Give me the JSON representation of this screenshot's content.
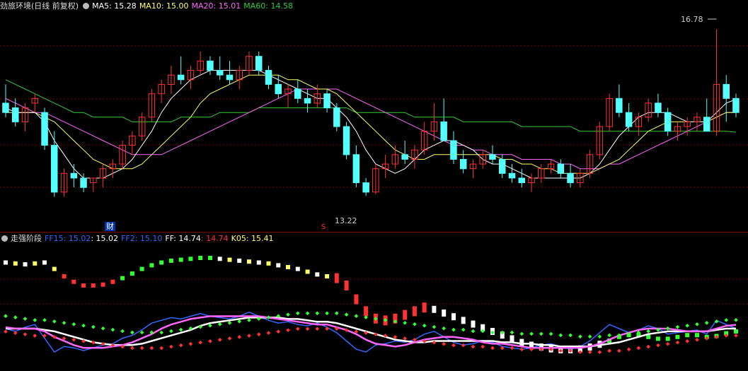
{
  "top": {
    "title": "劲旅环境(日线 前复权)",
    "ma5": "MA5: 15.28",
    "ma10": "MA10: 15.00",
    "ma20": "MA20: 15.01",
    "ma60": "MA60: 14.58",
    "high_label": "16.78",
    "low_label": "13.22",
    "cai_label": "财",
    "s_label": "S"
  },
  "bottom": {
    "title": "走强阶段",
    "ff15": "FF15: 15.02",
    "ff15_val": ": 15.02",
    "ff2": "FF2: 15.10",
    "ff": "FF: 14.74",
    "ff_red": ": 14.74",
    "k05": "K05: 15.41"
  },
  "colors": {
    "up": "#ff3232",
    "down": "#54ffff",
    "ma5": "#ffffff",
    "ma10": "#ffff66",
    "ma20": "#ff66ff",
    "ma60": "#33cc33",
    "ff15": "#3366ff",
    "ff2": "#3366ff",
    "ff": "#ffffff",
    "ffred": "#ff3232",
    "k05": "#ffff66"
  },
  "chart_data": {
    "type": "candlestick",
    "ylim": [
      12.8,
      17.1
    ],
    "candles": [
      [
        15.2,
        15.6,
        14.9,
        15.0
      ],
      [
        15.1,
        15.3,
        14.7,
        14.8
      ],
      [
        14.8,
        15.2,
        14.6,
        15.1
      ],
      [
        15.2,
        15.4,
        15.0,
        15.3
      ],
      [
        15.0,
        15.1,
        14.2,
        14.3
      ],
      [
        14.3,
        14.6,
        13.2,
        13.3
      ],
      [
        13.3,
        13.8,
        13.2,
        13.7
      ],
      [
        13.7,
        13.9,
        13.4,
        13.6
      ],
      [
        13.6,
        13.7,
        13.3,
        13.4
      ],
      [
        13.5,
        13.6,
        13.3,
        13.6
      ],
      [
        13.6,
        13.9,
        13.4,
        13.8
      ],
      [
        13.8,
        14.0,
        13.6,
        13.9
      ],
      [
        13.9,
        14.4,
        13.8,
        14.3
      ],
      [
        14.3,
        14.6,
        14.1,
        14.5
      ],
      [
        14.5,
        15.0,
        14.4,
        14.9
      ],
      [
        14.9,
        15.5,
        14.8,
        15.4
      ],
      [
        15.4,
        15.7,
        15.2,
        15.6
      ],
      [
        15.6,
        16.0,
        15.4,
        15.8
      ],
      [
        15.8,
        16.2,
        15.6,
        15.7
      ],
      [
        15.7,
        16.0,
        15.5,
        15.9
      ],
      [
        15.9,
        16.3,
        15.8,
        16.1
      ],
      [
        16.1,
        16.2,
        15.8,
        15.9
      ],
      [
        15.9,
        16.2,
        15.7,
        15.8
      ],
      [
        15.8,
        16.1,
        15.6,
        15.7
      ],
      [
        15.7,
        16.0,
        15.5,
        15.9
      ],
      [
        15.9,
        16.3,
        15.8,
        16.2
      ],
      [
        16.2,
        16.3,
        15.8,
        15.9
      ],
      [
        15.9,
        16.0,
        15.5,
        15.6
      ],
      [
        15.6,
        15.8,
        15.3,
        15.4
      ],
      [
        15.4,
        15.6,
        15.1,
        15.5
      ],
      [
        15.5,
        15.7,
        15.2,
        15.3
      ],
      [
        15.3,
        15.5,
        15.0,
        15.2
      ],
      [
        15.2,
        15.6,
        15.1,
        15.4
      ],
      [
        15.4,
        15.5,
        15.0,
        15.1
      ],
      [
        15.1,
        15.2,
        14.6,
        14.7
      ],
      [
        14.7,
        14.8,
        14.0,
        14.1
      ],
      [
        14.1,
        14.3,
        13.4,
        13.5
      ],
      [
        13.5,
        13.6,
        13.22,
        13.3
      ],
      [
        13.3,
        13.9,
        13.25,
        13.8
      ],
      [
        13.8,
        14.1,
        13.6,
        13.9
      ],
      [
        13.9,
        14.3,
        13.8,
        14.1
      ],
      [
        14.1,
        14.4,
        13.9,
        14.0
      ],
      [
        14.0,
        14.3,
        13.8,
        14.2
      ],
      [
        14.2,
        14.8,
        14.1,
        14.6
      ],
      [
        14.6,
        15.2,
        14.4,
        14.8
      ],
      [
        14.8,
        15.3,
        14.5,
        14.4
      ],
      [
        14.4,
        14.6,
        13.9,
        14.0
      ],
      [
        14.0,
        14.2,
        13.7,
        13.8
      ],
      [
        13.8,
        14.0,
        13.6,
        13.9
      ],
      [
        13.9,
        14.2,
        13.8,
        14.1
      ],
      [
        14.1,
        14.3,
        13.9,
        14.0
      ],
      [
        14.0,
        14.1,
        13.6,
        13.7
      ],
      [
        13.7,
        13.9,
        13.5,
        13.6
      ],
      [
        13.6,
        13.8,
        13.4,
        13.5
      ],
      [
        13.5,
        13.7,
        13.3,
        13.6
      ],
      [
        13.6,
        13.9,
        13.5,
        13.8
      ],
      [
        13.8,
        14.0,
        13.7,
        13.9
      ],
      [
        13.9,
        14.0,
        13.6,
        13.7
      ],
      [
        13.7,
        13.9,
        13.4,
        13.5
      ],
      [
        13.5,
        13.8,
        13.4,
        13.7
      ],
      [
        13.7,
        14.2,
        13.6,
        14.1
      ],
      [
        14.1,
        14.8,
        14.0,
        14.7
      ],
      [
        14.7,
        15.4,
        14.6,
        15.3
      ],
      [
        15.3,
        15.6,
        14.9,
        15.0
      ],
      [
        15.0,
        15.2,
        14.6,
        14.7
      ],
      [
        14.7,
        15.0,
        14.5,
        14.9
      ],
      [
        14.9,
        15.3,
        14.8,
        15.2
      ],
      [
        15.2,
        15.4,
        14.9,
        15.0
      ],
      [
        15.0,
        15.1,
        14.5,
        14.6
      ],
      [
        14.6,
        14.8,
        14.4,
        14.7
      ],
      [
        14.7,
        14.9,
        14.5,
        14.8
      ],
      [
        14.8,
        15.0,
        14.6,
        14.9
      ],
      [
        14.9,
        15.3,
        14.8,
        14.6
      ],
      [
        14.6,
        16.78,
        14.5,
        15.6
      ],
      [
        15.6,
        15.8,
        14.8,
        15.3
      ],
      [
        15.3,
        15.4,
        14.9,
        15.0
      ]
    ],
    "ma5": [
      15.1,
      15.0,
      15.0,
      15.0,
      14.8,
      14.4,
      14.1,
      13.8,
      13.6,
      13.6,
      13.6,
      13.7,
      13.8,
      14.0,
      14.3,
      14.6,
      15.0,
      15.3,
      15.5,
      15.7,
      15.8,
      15.9,
      15.9,
      15.9,
      15.9,
      15.9,
      15.9,
      15.8,
      15.7,
      15.6,
      15.5,
      15.4,
      15.3,
      15.3,
      15.1,
      14.9,
      14.6,
      14.2,
      13.9,
      13.8,
      13.7,
      13.8,
      14.0,
      14.2,
      14.3,
      14.4,
      14.4,
      14.3,
      14.2,
      14.0,
      13.9,
      13.9,
      13.8,
      13.7,
      13.6,
      13.6,
      13.6,
      13.6,
      13.6,
      13.6,
      13.7,
      13.9,
      14.2,
      14.5,
      14.7,
      14.9,
      15.0,
      15.0,
      15.0,
      14.9,
      14.8,
      14.8,
      14.8,
      15.0,
      15.2,
      15.28
    ],
    "ma10": [
      15.0,
      15.0,
      15.0,
      15.0,
      14.9,
      14.8,
      14.6,
      14.4,
      14.2,
      14.0,
      13.9,
      13.8,
      13.8,
      13.8,
      13.9,
      14.1,
      14.3,
      14.5,
      14.7,
      14.9,
      15.2,
      15.4,
      15.5,
      15.6,
      15.7,
      15.8,
      15.8,
      15.8,
      15.8,
      15.7,
      15.7,
      15.6,
      15.5,
      15.5,
      15.4,
      15.2,
      15.0,
      14.8,
      14.6,
      14.4,
      14.2,
      14.1,
      14.0,
      14.0,
      14.1,
      14.1,
      14.1,
      14.1,
      14.1,
      14.1,
      14.1,
      14.0,
      14.0,
      13.9,
      13.9,
      13.8,
      13.8,
      13.7,
      13.7,
      13.7,
      13.7,
      13.8,
      13.9,
      14.0,
      14.2,
      14.4,
      14.6,
      14.7,
      14.8,
      14.8,
      14.8,
      14.8,
      14.8,
      14.9,
      15.0,
      15.0
    ],
    "ma20": [
      15.3,
      15.2,
      15.1,
      15.0,
      15.0,
      14.9,
      14.8,
      14.7,
      14.6,
      14.5,
      14.4,
      14.3,
      14.2,
      14.1,
      14.1,
      14.1,
      14.1,
      14.2,
      14.3,
      14.4,
      14.5,
      14.6,
      14.7,
      14.8,
      14.9,
      15.0,
      15.1,
      15.2,
      15.3,
      15.4,
      15.5,
      15.5,
      15.5,
      15.5,
      15.5,
      15.4,
      15.3,
      15.2,
      15.1,
      15.0,
      14.9,
      14.8,
      14.7,
      14.6,
      14.5,
      14.4,
      14.3,
      14.3,
      14.2,
      14.2,
      14.1,
      14.1,
      14.1,
      14.0,
      14.0,
      14.0,
      14.0,
      13.9,
      13.9,
      13.8,
      13.8,
      13.8,
      13.9,
      13.9,
      14.0,
      14.1,
      14.2,
      14.3,
      14.4,
      14.5,
      14.6,
      14.7,
      14.8,
      14.9,
      15.0,
      15.01
    ],
    "ma60": [
      15.7,
      15.6,
      15.5,
      15.4,
      15.3,
      15.2,
      15.1,
      15.0,
      15.0,
      14.9,
      14.9,
      14.9,
      14.9,
      14.8,
      14.8,
      14.8,
      14.8,
      14.8,
      14.9,
      14.9,
      14.9,
      14.9,
      15.0,
      15.0,
      15.0,
      15.0,
      15.1,
      15.1,
      15.1,
      15.1,
      15.1,
      15.1,
      15.1,
      15.1,
      15.1,
      15.1,
      15.0,
      15.0,
      15.0,
      15.0,
      15.0,
      15.0,
      14.9,
      14.9,
      14.9,
      14.9,
      14.9,
      14.8,
      14.8,
      14.8,
      14.8,
      14.8,
      14.8,
      14.7,
      14.7,
      14.7,
      14.7,
      14.7,
      14.7,
      14.6,
      14.6,
      14.6,
      14.6,
      14.6,
      14.6,
      14.6,
      14.6,
      14.6,
      14.6,
      14.6,
      14.6,
      14.6,
      14.6,
      14.6,
      14.6,
      14.58
    ],
    "upper_dots": [
      0.05,
      0.06,
      0.07,
      0.06,
      0.05,
      0.12,
      0.2,
      0.26,
      0.3,
      0.3,
      0.29,
      0.26,
      0.22,
      0.17,
      0.12,
      0.08,
      0.05,
      0.03,
      0.02,
      0.01,
      0.0,
      0.0,
      0.01,
      0.02,
      0.03,
      0.04,
      0.05,
      0.06,
      0.08,
      0.1,
      0.12,
      0.15,
      0.18,
      0.2,
      0.22,
      0.3,
      0.45,
      0.58,
      0.66,
      0.68,
      0.66,
      0.62,
      0.58,
      0.54,
      0.56,
      0.6,
      0.64,
      0.68,
      0.72,
      0.76,
      0.8,
      0.84,
      0.88,
      0.92,
      0.95,
      0.97,
      0.99,
      1.0,
      1.0,
      0.99,
      0.97,
      0.94,
      0.9,
      0.86,
      0.84,
      0.84,
      0.86,
      0.88,
      0.88,
      0.86,
      0.84,
      0.84,
      0.86,
      0.85,
      0.82,
      0.8
    ]
  }
}
